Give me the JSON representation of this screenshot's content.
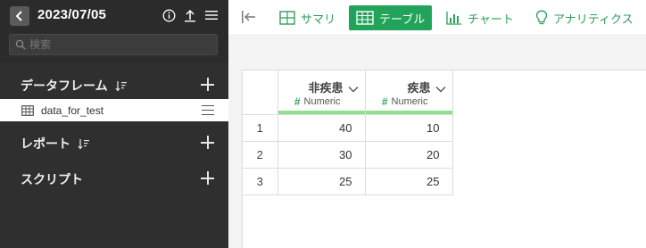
{
  "header": {
    "date": "2023/07/05",
    "search_placeholder": "検索"
  },
  "sidebar": {
    "sections": [
      {
        "title": "データフレーム"
      },
      {
        "title": "レポート"
      },
      {
        "title": "スクリプト"
      }
    ],
    "dataframe_item": "data_for_test"
  },
  "toolbar": {
    "tabs": [
      {
        "label": "サマリ",
        "icon": "summary-icon"
      },
      {
        "label": "テーブル",
        "icon": "table-icon",
        "active": true
      },
      {
        "label": "チャート",
        "icon": "chart-icon"
      },
      {
        "label": "アナリティクス",
        "icon": "lightbulb-icon"
      }
    ]
  },
  "table": {
    "columns": [
      {
        "name": "非疾患",
        "type": "Numeric"
      },
      {
        "name": "疾患",
        "type": "Numeric"
      }
    ],
    "rows": [
      {
        "index": "1",
        "values": [
          "40",
          "10"
        ]
      },
      {
        "index": "2",
        "values": [
          "30",
          "20"
        ]
      },
      {
        "index": "3",
        "values": [
          "25",
          "25"
        ]
      }
    ]
  },
  "colors": {
    "accent": "#22a35a",
    "sidebar_bg": "#2f2f2f",
    "numeric_bar": "#8fe08f"
  }
}
